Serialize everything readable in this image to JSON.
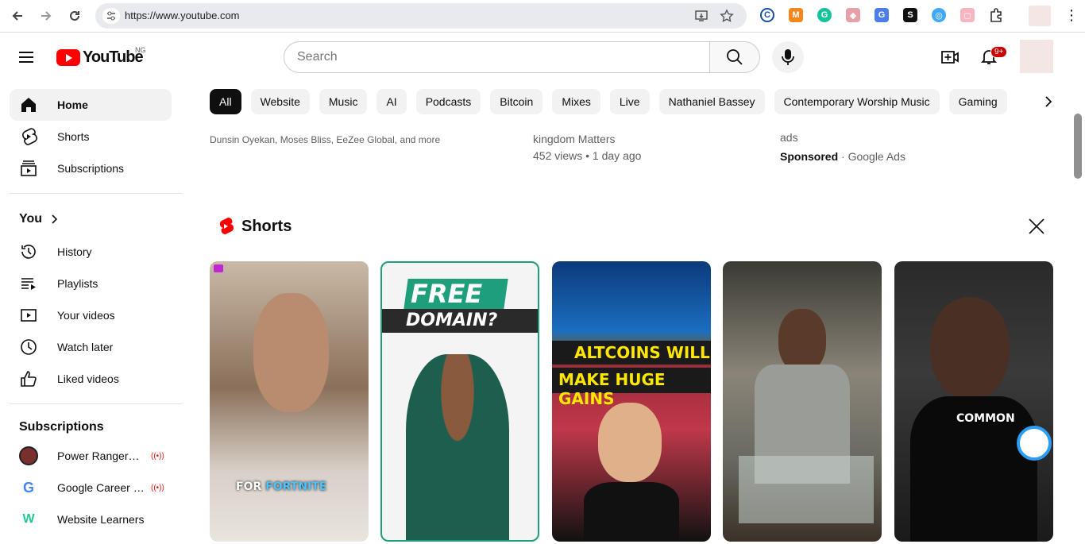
{
  "browser": {
    "url": "https://www.youtube.com"
  },
  "masthead": {
    "logo_text": "YouTube",
    "country_code": "NG",
    "search_placeholder": "Search",
    "notification_count": "9+"
  },
  "sidebar": {
    "main": [
      {
        "label": "Home",
        "icon": "home-icon",
        "active": true
      },
      {
        "label": "Shorts",
        "icon": "shorts-icon"
      },
      {
        "label": "Subscriptions",
        "icon": "subscriptions-icon"
      }
    ],
    "you_heading": "You",
    "you_items": [
      {
        "label": "History",
        "icon": "history-icon"
      },
      {
        "label": "Playlists",
        "icon": "playlists-icon"
      },
      {
        "label": "Your videos",
        "icon": "your-videos-icon"
      },
      {
        "label": "Watch later",
        "icon": "watch-later-icon"
      },
      {
        "label": "Liked videos",
        "icon": "liked-videos-icon"
      }
    ],
    "subscriptions_heading": "Subscriptions",
    "subscriptions": [
      {
        "label": "Power Rangers ...",
        "live": true,
        "color": "#7a2f2f"
      },
      {
        "label": "Google Career Ce...",
        "live": true,
        "color": "#4285f4"
      },
      {
        "label": "Website Learners",
        "live": false,
        "color": "#20c997"
      }
    ]
  },
  "chips": [
    "All",
    "Website",
    "Music",
    "AI",
    "Podcasts",
    "Bitcoin",
    "Mixes",
    "Live",
    "Nathaniel Bassey",
    "Contemporary Worship Music",
    "Gaming"
  ],
  "videos_partial": [
    {
      "channel": "Dunsin Oyekan, Moses Bliss, EeZee Global, and more"
    },
    {
      "channel": "kingdom Matters",
      "stats": "452 views • 1 day ago"
    },
    {
      "desc_tail": "ads",
      "sponsored": "Sponsored",
      "advertiser": "Google Ads"
    }
  ],
  "shorts": {
    "heading": "Shorts",
    "items": [
      {
        "caption_1": "FOR ",
        "caption_2": "FORTNITE"
      },
      {
        "caption_1": "FREE",
        "caption_2": "DOMAIN?"
      },
      {
        "caption_1": "ALTCOINS WILL",
        "caption_2": "MAKE HUGE GAINS"
      },
      {},
      {
        "caption_1": "COMMON"
      }
    ]
  }
}
